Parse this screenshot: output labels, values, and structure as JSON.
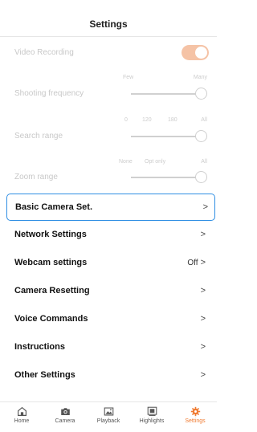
{
  "header": {
    "title": "Settings"
  },
  "disabled": {
    "video_recording": {
      "label": "Video Recording",
      "enabled": true
    },
    "shooting_frequency": {
      "label": "Shooting frequency",
      "ticks": [
        "Few",
        "Many"
      ],
      "value": "Many"
    },
    "search_range": {
      "label": "Search range",
      "ticks": [
        "0",
        "120",
        "180",
        "All"
      ],
      "value": "All"
    },
    "zoom_range": {
      "label": "Zoom range",
      "ticks": [
        "None",
        "Opt only",
        "All"
      ],
      "value": "All"
    }
  },
  "menu": [
    {
      "label": "Basic Camera Set.",
      "value": "",
      "selected": true
    },
    {
      "label": "Network Settings",
      "value": ""
    },
    {
      "label": "Webcam settings",
      "value": "Off"
    },
    {
      "label": "Camera Resetting",
      "value": ""
    },
    {
      "label": "Voice Commands",
      "value": ""
    },
    {
      "label": "Instructions",
      "value": ""
    },
    {
      "label": "Other Settings",
      "value": ""
    }
  ],
  "chevron": ">",
  "tabs": [
    {
      "label": "Home",
      "icon": "home-icon"
    },
    {
      "label": "Camera",
      "icon": "camera-icon"
    },
    {
      "label": "Playback",
      "icon": "playback-icon"
    },
    {
      "label": "Highlights",
      "icon": "highlights-icon"
    },
    {
      "label": "Settings",
      "icon": "gear-icon",
      "active": true
    }
  ],
  "colors": {
    "accent": "#f07b32",
    "toggle_disabled": "#f5c3a6",
    "focus_border": "#2f8ee3"
  }
}
